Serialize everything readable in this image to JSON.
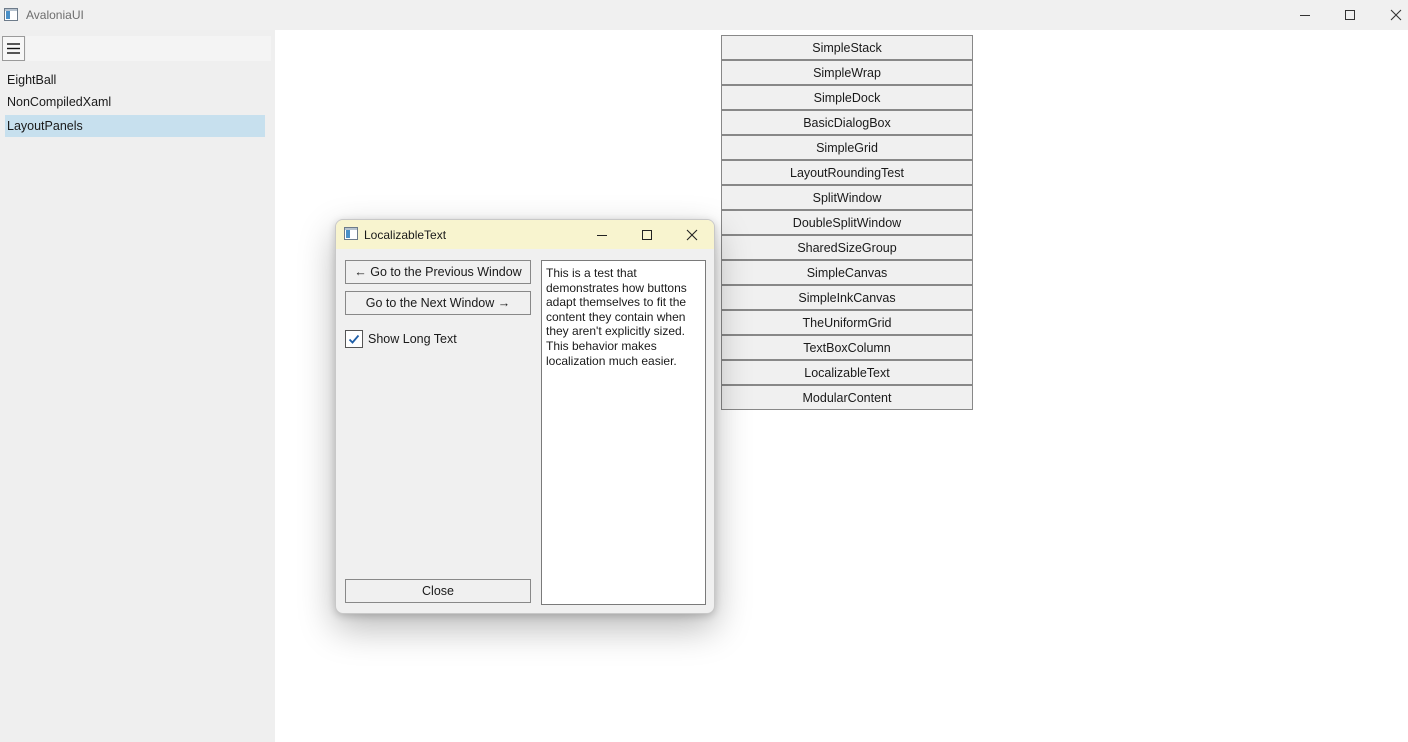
{
  "window": {
    "title": "AvaloniaUI",
    "controls": {
      "minimize_icon": "minimize-icon",
      "maximize_icon": "maximize-icon",
      "close_icon": "close-icon"
    }
  },
  "sidebar": {
    "menu_icon": "hamburger-icon",
    "items": [
      {
        "label": "EightBall",
        "selected": false
      },
      {
        "label": "NonCompiledXaml",
        "selected": false
      },
      {
        "label": "LayoutPanels",
        "selected": true
      }
    ],
    "selected_color": "#c7e0ee"
  },
  "examples": {
    "buttons": [
      "SimpleStack",
      "SimpleWrap",
      "SimpleDock",
      "BasicDialogBox",
      "SimpleGrid",
      "LayoutRoundingTest",
      "SplitWindow",
      "DoubleSplitWindow",
      "SharedSizeGroup",
      "SimpleCanvas",
      "SimpleInkCanvas",
      "TheUniformGrid",
      "TextBoxColumn",
      "LocalizableText",
      "ModularContent"
    ]
  },
  "dialog": {
    "title": "LocalizableText",
    "titlebar_color": "#f8f4cf",
    "prev_button": "← Go to the Previous Window",
    "next_button": "Go to the Next Window →",
    "checkbox_label": "Show Long Text",
    "checkbox_checked": true,
    "close_button": "Close",
    "text_lines": [
      "This is a test that",
      "demonstrates how buttons",
      "adapt themselves to fit the",
      "content they contain when",
      "they aren't explicitly sized.",
      "This behavior makes",
      "localization much easier."
    ]
  }
}
